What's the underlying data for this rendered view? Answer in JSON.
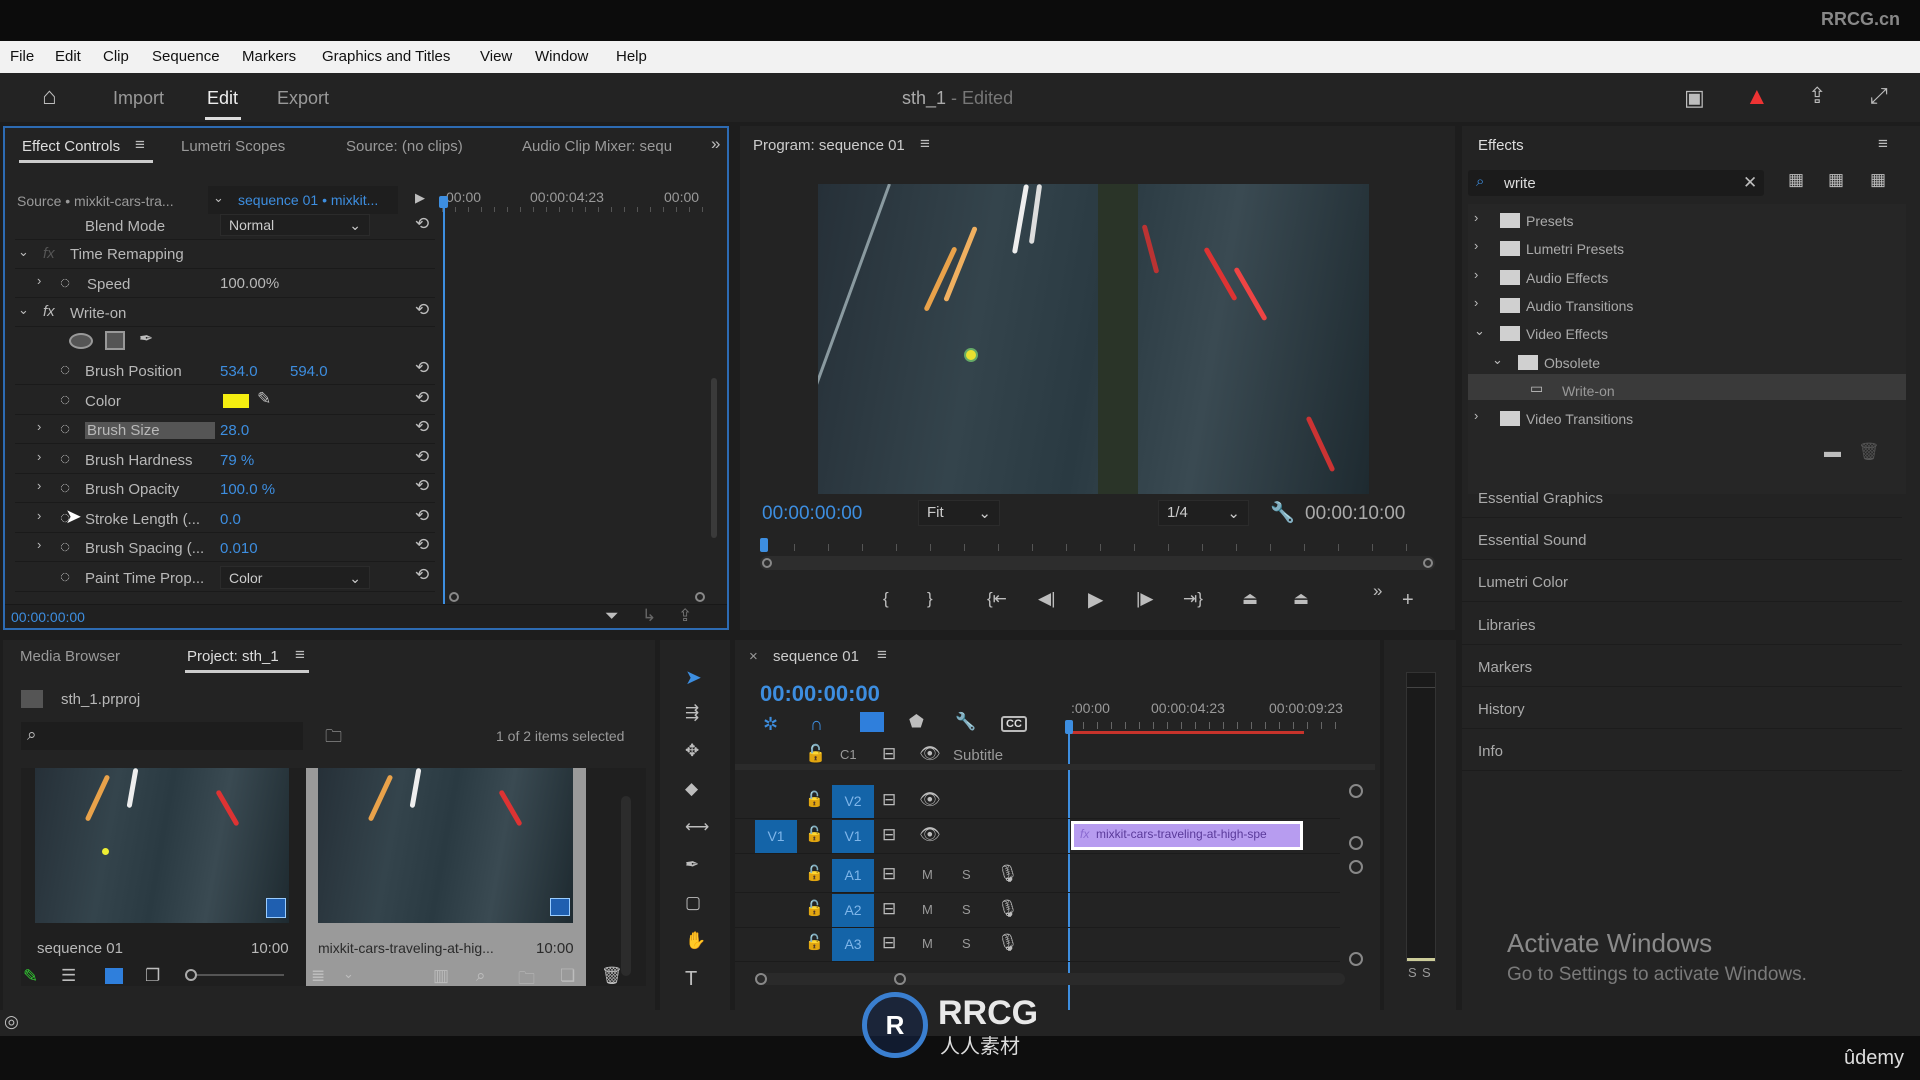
{
  "watermark_top": "RRCG.cn",
  "menu": [
    "File",
    "Edit",
    "Clip",
    "Sequence",
    "Markers",
    "Graphics and Titles",
    "View",
    "Window",
    "Help"
  ],
  "header": {
    "tabs": [
      "Import",
      "Edit",
      "Export"
    ],
    "active_tab": "Edit",
    "title": "sth_1",
    "title_suffix": " - Edited"
  },
  "effect_controls": {
    "tabs": [
      "Effect Controls",
      "Lumetri Scopes",
      "Source: (no clips)",
      "Audio Clip Mixer: sequ"
    ],
    "source_label": "Source • mixkit-cars-tra...",
    "sequence_label": "sequence 01 • mixkit...",
    "ruler": [
      "00:00",
      "00:00:04:23",
      "00:00"
    ],
    "blend_mode_label": "Blend Mode",
    "blend_mode_value": "Normal",
    "time_remapping": "Time Remapping",
    "speed_label": "Speed",
    "speed_value": "100.00%",
    "write_on": "Write-on",
    "params": [
      {
        "label": "Brush Position",
        "value": "534.0",
        "value2": "594.0"
      },
      {
        "label": "Color",
        "value": ""
      },
      {
        "label": "Brush Size",
        "value": "28.0"
      },
      {
        "label": "Brush Hardness",
        "value": "79 %"
      },
      {
        "label": "Brush Opacity",
        "value": "100.0 %"
      },
      {
        "label": "Stroke Length (...",
        "value": "0.0"
      },
      {
        "label": "Brush Spacing (...",
        "value": "0.010"
      },
      {
        "label": "Paint Time Prop...",
        "value": "Color"
      }
    ],
    "brush_color": "#f5ee10",
    "timecode": "00:00:00:00"
  },
  "program": {
    "title": "Program: sequence 01",
    "timecode": "00:00:00:00",
    "zoom": "Fit",
    "resolution": "1/4",
    "duration": "00:00:10:00"
  },
  "effects": {
    "title": "Effects",
    "search": "write",
    "tree": [
      {
        "label": "Presets",
        "expanded": false
      },
      {
        "label": "Lumetri Presets",
        "expanded": false
      },
      {
        "label": "Audio Effects",
        "expanded": false
      },
      {
        "label": "Audio Transitions",
        "expanded": false
      },
      {
        "label": "Video Effects",
        "expanded": true
      },
      {
        "label": "Obsolete",
        "expanded": true
      },
      {
        "label": "Write-on",
        "selected": true
      },
      {
        "label": "Video Transitions",
        "expanded": false
      }
    ],
    "panels": [
      "Essential Graphics",
      "Essential Sound",
      "Lumetri Color",
      "Libraries",
      "Markers",
      "History",
      "Info"
    ]
  },
  "activate": {
    "title": "Activate Windows",
    "subtitle": "Go to Settings to activate Windows."
  },
  "project": {
    "tabs": [
      "Media Browser",
      "Project: sth_1"
    ],
    "file": "sth_1.prproj",
    "selection": "1 of 2 items selected",
    "items": [
      {
        "name": "sequence 01",
        "duration": "10:00"
      },
      {
        "name": "mixkit-cars-traveling-at-hig...",
        "duration": "10:00"
      }
    ]
  },
  "timeline": {
    "tab": "sequence 01",
    "timecode": "00:00:00:00",
    "ruler": [
      ":00:00",
      "00:00:04:23",
      "00:00:09:23"
    ],
    "subtitle_track": "C1",
    "subtitle_label": "Subtitle",
    "video_tracks": [
      "V2",
      "V1"
    ],
    "source_patch": "V1",
    "audio_tracks": [
      "A1",
      "A2",
      "A3"
    ],
    "mute": "M",
    "solo": "S",
    "clip": "mixkit-cars-traveling-at-high-spe",
    "clip_color": "#b79cf0"
  },
  "meter": {
    "labels": [
      "S",
      "S"
    ]
  },
  "watermark": {
    "text": "RRCG",
    "subtext": "人人素材"
  },
  "udemy": "ûdemy"
}
